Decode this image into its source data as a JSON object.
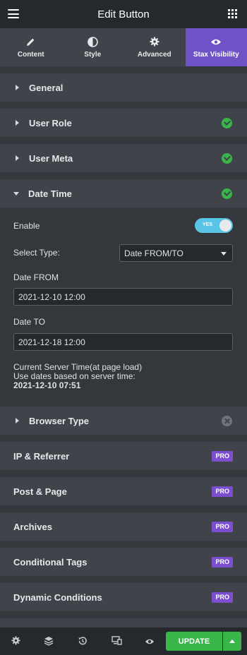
{
  "header": {
    "title": "Edit Button",
    "menu_icon": "hamburger-menu-icon",
    "apps_icon": "grid-apps-icon"
  },
  "tabs": [
    {
      "label": "Content",
      "icon": "pencil-icon"
    },
    {
      "label": "Style",
      "icon": "half-circle-icon"
    },
    {
      "label": "Advanced",
      "icon": "gear-icon"
    },
    {
      "label": "Stax Visibility",
      "icon": "eye-icon",
      "active": true
    }
  ],
  "sections": {
    "general": "General",
    "user_role": "User Role",
    "user_meta": "User Meta",
    "date_time": "Date Time",
    "browser_type": "Browser Type",
    "ip_referrer": "IP & Referrer",
    "post_page": "Post & Page",
    "archives": "Archives",
    "conditional_tags": "Conditional Tags",
    "dynamic_conditions": "Dynamic Conditions"
  },
  "pro_badge": "PRO",
  "date_time": {
    "enable_label": "Enable",
    "toggle_text": "YES",
    "select_type_label": "Select Type:",
    "select_type_value": "Date FROM/TO",
    "date_from_label": "Date FROM",
    "date_from_value": "2021-12-10 12:00",
    "date_to_label": "Date TO",
    "date_to_value": "2021-12-18 12:00",
    "server_time_line1": "Current Server Time(at page load)",
    "server_time_line2": "Use dates based on server time:",
    "server_time_value": "2021-12-10 07:51"
  },
  "footer": {
    "update_label": "UPDATE",
    "icons": [
      "settings-icon",
      "layers-icon",
      "history-icon",
      "responsive-icon",
      "preview-eye-icon"
    ]
  },
  "colors": {
    "accent": "#6e52c6",
    "success": "#39b54a",
    "pro": "#7b4fcf",
    "toggle": "#58c4e6"
  }
}
